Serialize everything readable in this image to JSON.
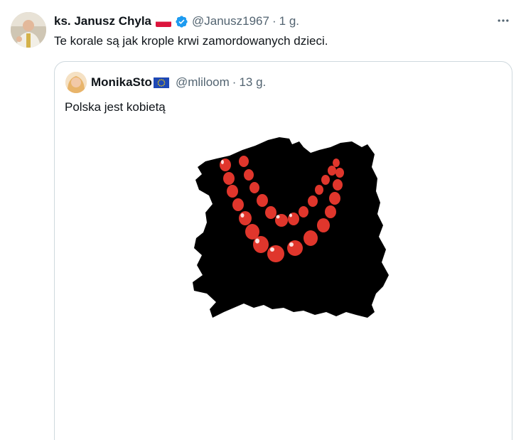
{
  "tweet": {
    "display_name": "ks. Janusz Chyla",
    "handle": "@Janusz1967",
    "separator": "·",
    "time": "1 g.",
    "text": "Te korale są jak krople krwi zamordowanych dzieci.",
    "more_icon": "more-horizontal-icon",
    "verified_icon": "verified-badge-icon",
    "flag": "poland-flag"
  },
  "quote": {
    "display_name": "MonikaSto",
    "handle": "@mliloom",
    "separator": "·",
    "time": "13 g.",
    "text": "Polska jest kobietą",
    "flag": "eu-flag",
    "media": "poland-map-with-red-bead-necklace-image"
  },
  "colors": {
    "text_primary": "#0f1419",
    "text_secondary": "#536471",
    "verified_blue": "#1d9bf0",
    "border": "#cfd9de",
    "bead_red": "#e0362c",
    "map_black": "#000000"
  }
}
